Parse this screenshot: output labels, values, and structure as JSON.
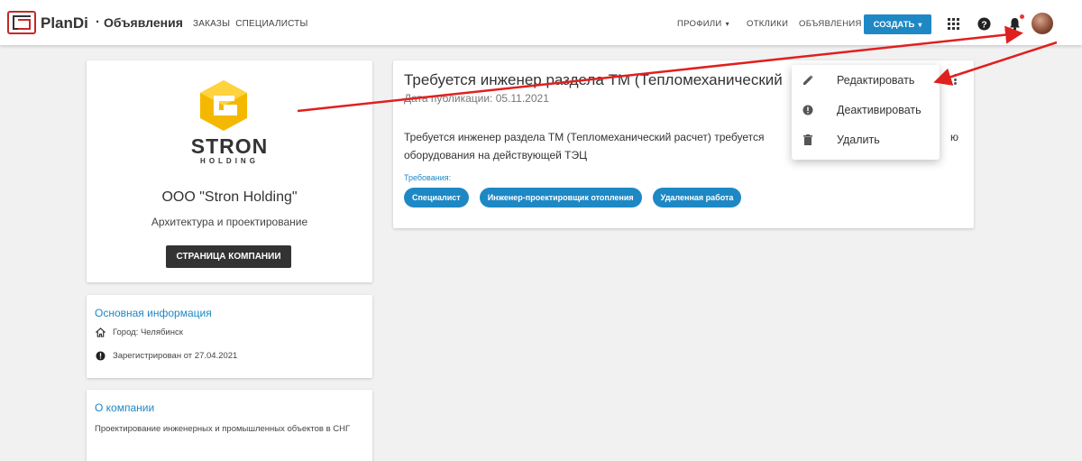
{
  "header": {
    "brand": "PlanDi",
    "separator": "·",
    "section": "Объявления",
    "nav_left": [
      "ЗАКАЗЫ",
      "СПЕЦИАЛИСТЫ"
    ],
    "nav_profiles": "ПРОФИЛИ",
    "nav_responses": "ОТКЛИКИ",
    "nav_ads": "ОБЪЯВЛЕНИЯ",
    "create_label": "СОЗДАТЬ",
    "icons": [
      "apps-grid-icon",
      "help-icon",
      "bell-icon",
      "avatar"
    ]
  },
  "company": {
    "logo_word": "STRON",
    "logo_sub": "HOLDING",
    "name": "ООО \"Stron Holding\"",
    "description": "Архитектура и проектирование",
    "page_button": "СТРАНИЦА КОМПАНИИ"
  },
  "basic_info": {
    "title": "Основная информация",
    "city": "Город: Челябинск",
    "registered": "Зарегистрирован от 27.04.2021"
  },
  "about": {
    "title": "О компании",
    "text": "Проектирование инженерных и промышленных объектов в СНГ"
  },
  "job": {
    "title": "Требуется инженер раздела ТМ (Тепломеханический",
    "date": "Дата публикации: 05.11.2021",
    "body": "Требуется инженер раздела ТМ (Тепломеханический расчет) требуется ... ю оборудования на действующей ТЭЦ",
    "body_line1": "Требуется инженер раздела ТМ (Тепломеханический расчет) требуется",
    "body_line1_tail": "ю",
    "body_line2": "оборудования на действующей ТЭЦ",
    "requirements_label": "Требования:",
    "tags": [
      "Специалист",
      "Инженер-проектировщик отопления",
      "Удаленная работа"
    ]
  },
  "menu": {
    "items": [
      {
        "label": "Редактировать",
        "icon": "pencil-icon"
      },
      {
        "label": "Деактивировать",
        "icon": "alert-circle-icon"
      },
      {
        "label": "Удалить",
        "icon": "trash-icon"
      }
    ]
  },
  "colors": {
    "accent": "#1e88c5",
    "dark_button": "#333333",
    "arrow": "#e0201e",
    "background": "#f1f1f1"
  }
}
